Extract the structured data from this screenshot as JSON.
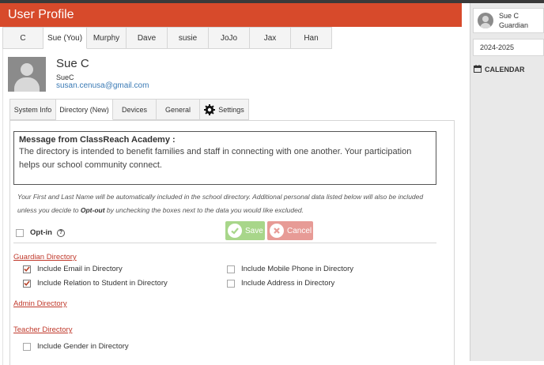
{
  "header": {
    "title": "User Profile"
  },
  "student_tabs": [
    {
      "label": "C",
      "active": false
    },
    {
      "label": "Sue (You)",
      "active": true
    },
    {
      "label": "Murphy",
      "active": false
    },
    {
      "label": "Dave",
      "active": false
    },
    {
      "label": "susie",
      "active": false
    },
    {
      "label": "JoJo",
      "active": false
    },
    {
      "label": "Jax",
      "active": false
    },
    {
      "label": "Han",
      "active": false
    }
  ],
  "profile": {
    "name": "Sue C",
    "username": "SueC",
    "email": "susan.cenusa@gmail.com"
  },
  "profile_tabs": [
    {
      "label": "System Info",
      "active": false
    },
    {
      "label": "Directory (New)",
      "active": true
    },
    {
      "label": "Devices",
      "active": false
    },
    {
      "label": "General",
      "active": false
    },
    {
      "label": "Settings",
      "active": false,
      "icon": "gear-icon"
    }
  ],
  "message": {
    "title": "Message from ClassReach Academy :",
    "body": "The directory is intended to benefit families and staff in connecting with one another. Your participation helps our school community connect."
  },
  "info": {
    "part1": "Your First and Last Name will be automatically included in the school directory. Additional personal data listed below will also be included unless you decide to ",
    "bold": "Opt-out",
    "part2": " by unchecking the boxes next to the data you would like excluded."
  },
  "optin": {
    "label": "Opt-in",
    "checked": false,
    "help_icon": "question-circle-icon"
  },
  "buttons": {
    "save": "Save",
    "cancel": "Cancel"
  },
  "sections": {
    "guardian": {
      "title": "Guardian Directory",
      "options": [
        {
          "label": "Include Email in Directory",
          "checked": true
        },
        {
          "label": "Include Relation to Student in Directory",
          "checked": true
        },
        {
          "label": "Include Mobile Phone in Directory",
          "checked": false
        },
        {
          "label": "Include Address in Directory",
          "checked": false
        }
      ]
    },
    "admin": {
      "title": "Admin Directory"
    },
    "teacher": {
      "title": "Teacher Directory",
      "options": [
        {
          "label": "Include Gender in Directory",
          "checked": false
        }
      ]
    }
  },
  "sidebar": {
    "user_name": "Sue C",
    "user_role": "Guardian",
    "school_year": "2024-2025",
    "calendar_label": "CALENDAR"
  },
  "colors": {
    "header": "#d74a2b",
    "save": "#a8d68a",
    "cancel": "#e79b96",
    "section_title": "#c0392b",
    "link": "#3a7ab5"
  }
}
